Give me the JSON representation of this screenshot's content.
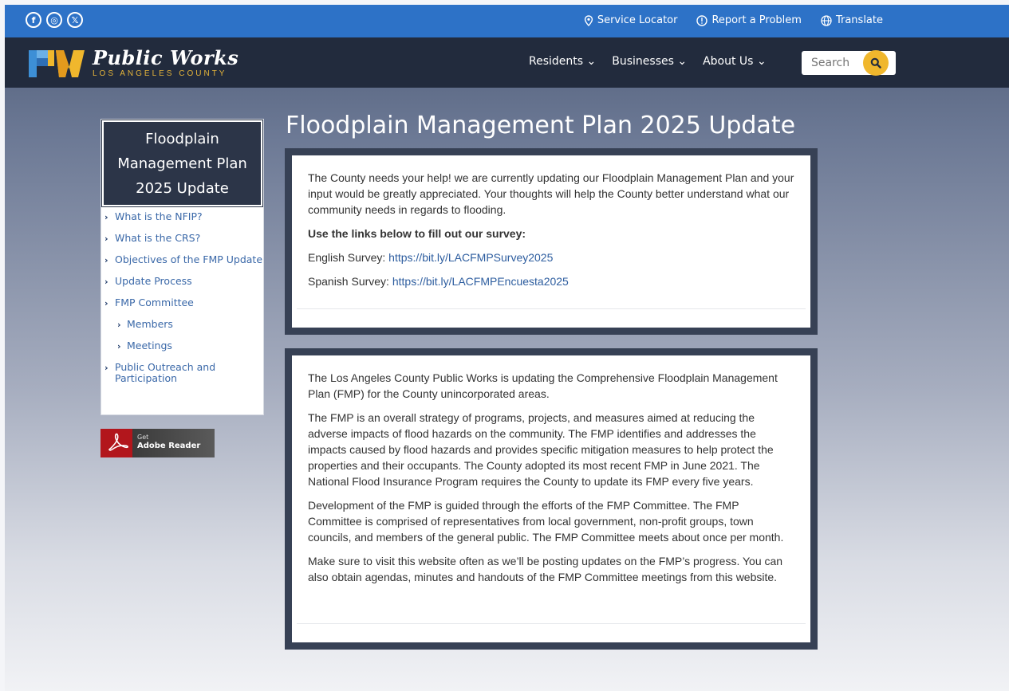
{
  "topbar": {
    "social": [
      {
        "icon": "facebook-icon",
        "glyph": "f"
      },
      {
        "icon": "instagram-icon",
        "glyph": "◎"
      },
      {
        "icon": "x-icon",
        "glyph": "𝕏"
      }
    ],
    "links": {
      "service_locator": "Service Locator",
      "report_problem": "Report a Problem",
      "translate": "Translate"
    }
  },
  "header": {
    "logo_title": "Public Works",
    "logo_subtitle": "LOS ANGELES COUNTY",
    "nav": {
      "residents": "Residents",
      "businesses": "Businesses",
      "about": "About Us"
    },
    "search_placeholder": "Search",
    "colors": {
      "topbar": "#2d72c7",
      "header": "#222b3d",
      "accent": "#f0b72d"
    }
  },
  "sidebar": {
    "title_lines": [
      "Floodplain",
      "Management Plan",
      "2025 Update"
    ],
    "items": [
      {
        "label": "What is the NFIP?"
      },
      {
        "label": "What is the CRS?"
      },
      {
        "label": "Objectives of the FMP Update"
      },
      {
        "label": "Update Process"
      },
      {
        "label": "FMP Committee"
      },
      {
        "label": "Members"
      },
      {
        "label": "Meetings"
      },
      {
        "label": "Public Outreach and Participation"
      }
    ],
    "adobe_get": "Get",
    "adobe_reader": "Adobe Reader"
  },
  "main": {
    "title": "Floodplain Management Plan 2025 Update",
    "survey": {
      "intro": "The County needs your help! we are currently updating our Floodplain Management Plan and your input would be greatly appreciated. Your thoughts will help the County better understand what our community needs in regards to flooding.",
      "heading": "Use the links below to fill out our survey:",
      "english_label": "English Survey: ",
      "english_link": "https://bit.ly/LACFMPSurvey2025",
      "spanish_label": "Spanish Survey: ",
      "spanish_link": "https://bit.ly/LACFMPEncuesta2025"
    },
    "about": {
      "p1": "The Los Angeles County Public Works is updating the Comprehensive Floodplain Management Plan (FMP) for the County unincorporated areas.",
      "p2": "The FMP is an overall strategy of programs, projects, and measures aimed at reducing the adverse impacts of flood hazards on the community. The FMP identifies and addresses the impacts caused by flood hazards and provides specific mitigation measures to help protect the properties and their occupants. The County adopted its most recent FMP in June 2021. The National Flood Insurance Program requires the County to update its FMP every five years.",
      "p3": "Development of the FMP is guided through the efforts of the FMP Committee. The FMP Committee is comprised of representatives from local government, non-profit groups, town councils, and members of the general public. The FMP Committee meets about once per month.",
      "p4": "Make sure to visit this website often as we’ll be posting updates on the FMP’s progress. You can also obtain agendas, minutes and handouts of the FMP Committee meetings from this website."
    }
  }
}
